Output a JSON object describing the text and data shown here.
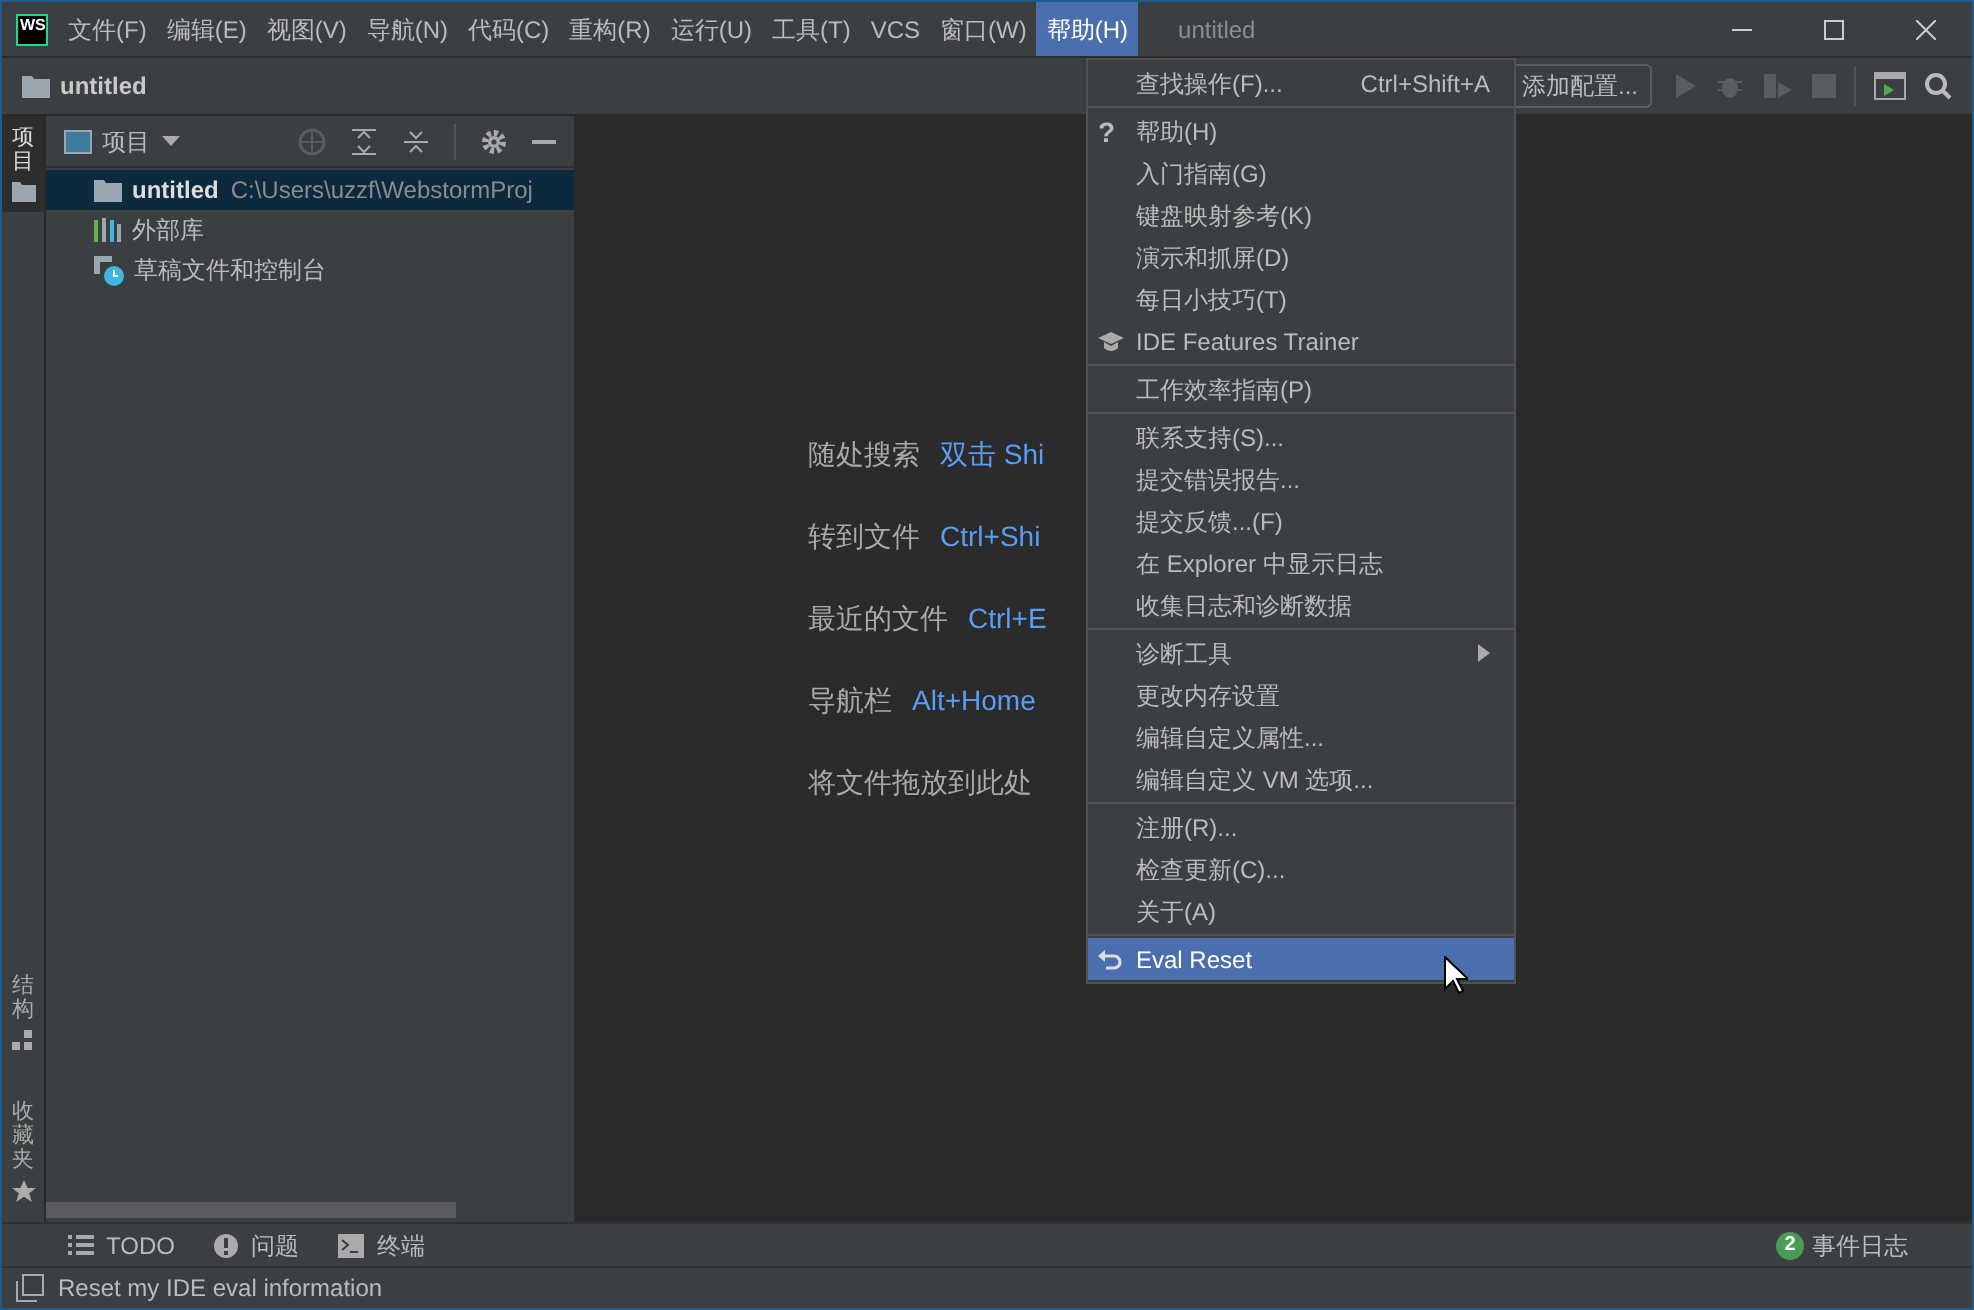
{
  "menu_bar": {
    "logo": "WS",
    "items": [
      {
        "label": "文件(F)",
        "selected": false
      },
      {
        "label": "编辑(E)",
        "selected": false
      },
      {
        "label": "视图(V)",
        "selected": false
      },
      {
        "label": "导航(N)",
        "selected": false
      },
      {
        "label": "代码(C)",
        "selected": false
      },
      {
        "label": "重构(R)",
        "selected": false
      },
      {
        "label": "运行(U)",
        "selected": false
      },
      {
        "label": "工具(T)",
        "selected": false
      },
      {
        "label": "VCS",
        "selected": false
      },
      {
        "label": "窗口(W)",
        "selected": false
      },
      {
        "label": "帮助(H)",
        "selected": true
      }
    ],
    "title": "untitled"
  },
  "nav_bar": {
    "project": "untitled",
    "run_config": "添加配置..."
  },
  "side_tabs": [
    {
      "label": "项目",
      "selected": true,
      "kind": "folder"
    },
    {
      "label": "结构",
      "selected": false,
      "kind": "structure"
    },
    {
      "label": "收藏夹",
      "selected": false,
      "kind": "star"
    }
  ],
  "project_panel": {
    "title": "项目",
    "tree": [
      {
        "label": "untitled",
        "path": "C:\\Users\\uzzf\\WebstormProj",
        "kind": "folder",
        "selected": true
      },
      {
        "label": "外部库",
        "kind": "library",
        "selected": false
      },
      {
        "label": "草稿文件和控制台",
        "kind": "scratch",
        "selected": false
      }
    ]
  },
  "editor_hints": [
    {
      "label": "随处搜索",
      "shortcut": "双击 Shi"
    },
    {
      "label": "转到文件",
      "shortcut": "Ctrl+Shi"
    },
    {
      "label": "最近的文件",
      "shortcut": "Ctrl+E"
    },
    {
      "label": "导航栏",
      "shortcut": "Alt+Home"
    },
    {
      "label": "将文件拖放到此处"
    }
  ],
  "help_menu": [
    [
      {
        "label": "查找操作(F)...",
        "shortcut": "Ctrl+Shift+A",
        "selected": false
      }
    ],
    [
      {
        "label": "帮助(H)",
        "kind": "question",
        "icon": "?",
        "selected": false
      },
      {
        "label": "入门指南(G)",
        "selected": false
      },
      {
        "label": "键盘映射参考(K)",
        "selected": false
      },
      {
        "label": "演示和抓屏(D)",
        "selected": false
      },
      {
        "label": "每日小技巧(T)",
        "selected": false
      },
      {
        "label": "IDE Features Trainer",
        "kind": "trainer",
        "selected": false
      }
    ],
    [
      {
        "label": "工作效率指南(P)",
        "selected": false
      }
    ],
    [
      {
        "label": "联系支持(S)...",
        "selected": false
      },
      {
        "label": "提交错误报告...",
        "selected": false
      },
      {
        "label": "提交反馈...(F)",
        "selected": false
      },
      {
        "label": "在 Explorer 中显示日志",
        "selected": false
      },
      {
        "label": "收集日志和诊断数据",
        "selected": false
      }
    ],
    [
      {
        "label": "诊断工具",
        "submenu": true,
        "selected": false
      },
      {
        "label": "更改内存设置",
        "selected": false
      },
      {
        "label": "编辑自定义属性...",
        "selected": false
      },
      {
        "label": "编辑自定义 VM 选项...",
        "selected": false
      }
    ],
    [
      {
        "label": "注册(R)...",
        "selected": false
      },
      {
        "label": "检查更新(C)...",
        "selected": false
      },
      {
        "label": "关于(A)",
        "selected": false
      }
    ],
    [
      {
        "label": "Eval Reset",
        "kind": "reset",
        "selected": true
      }
    ]
  ],
  "bottom_tabs": [
    {
      "label": "TODO",
      "kind": "list"
    },
    {
      "label": "问题",
      "kind": "problems"
    },
    {
      "label": "终端",
      "kind": "terminal"
    }
  ],
  "event_log": {
    "count": "2",
    "label": "事件日志"
  },
  "status_bar": {
    "message": "Reset my IDE eval information"
  }
}
